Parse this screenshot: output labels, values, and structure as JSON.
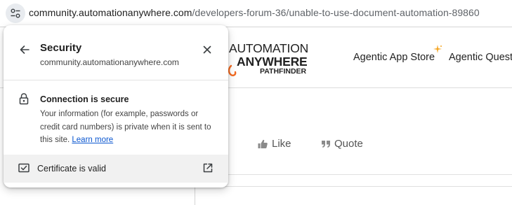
{
  "address_bar": {
    "host": "community.automationanywhere.com",
    "path": "/developers-forum-36/unable-to-use-document-automation-89860"
  },
  "header": {
    "logo": {
      "line1": "AUTOMATION",
      "line2": "ANYWHERE",
      "line3": "PATHFINDER"
    },
    "nav": {
      "app_store": "Agentic App Store",
      "agentic_quest": "Agentic Quest"
    }
  },
  "post_actions": {
    "like": "Like",
    "quote": "Quote"
  },
  "security_popup": {
    "title": "Security",
    "host": "community.automationanywhere.com",
    "connection_title": "Connection is secure",
    "connection_desc": "Your information (for example, passwords or credit card numbers) is private when it is sent to this site.",
    "learn_more": "Learn more",
    "certificate_label": "Certificate is valid"
  },
  "colors": {
    "link": "#0b57d0",
    "logo_accent": "#f26a21",
    "sparkle": "#f5a623"
  },
  "icons": [
    "tune-icon",
    "back-arrow-icon",
    "close-icon",
    "lock-icon",
    "certificate-icon",
    "external-link-icon",
    "thumbs-up-icon",
    "quote-icon",
    "sparkle-icon"
  ]
}
